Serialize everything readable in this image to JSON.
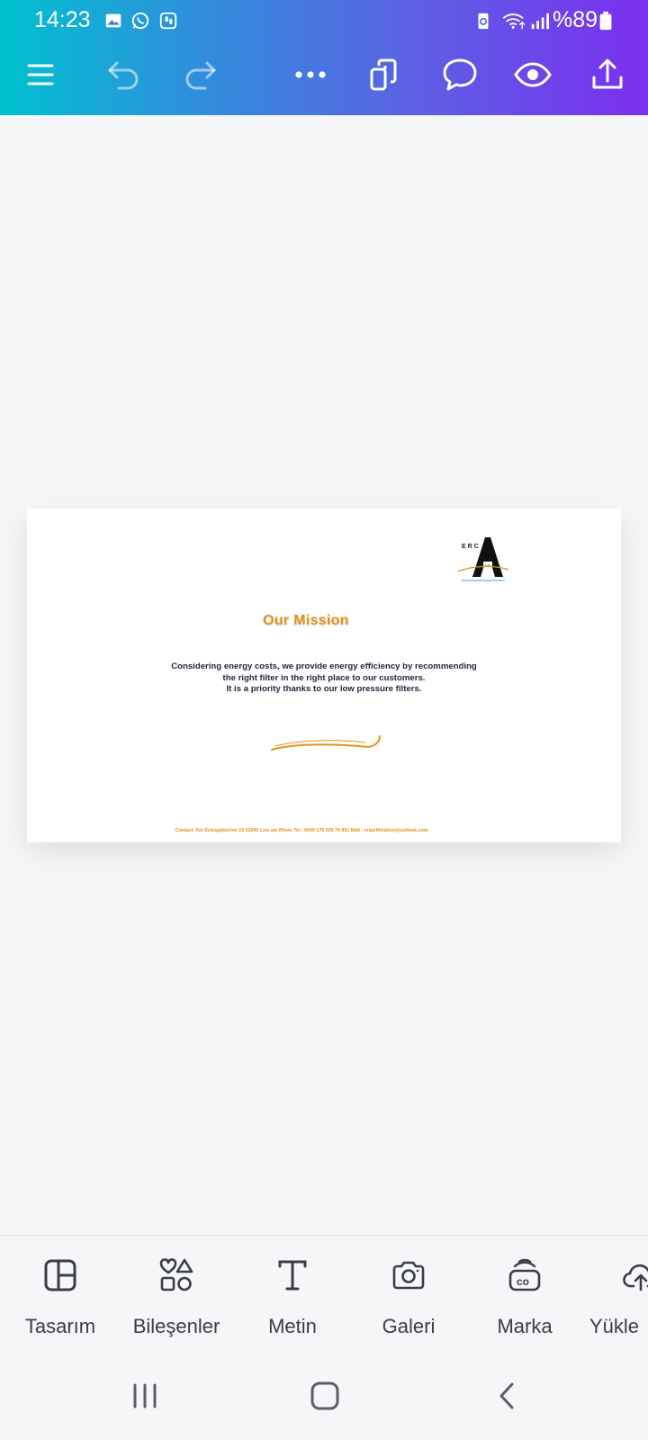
{
  "status_bar": {
    "time": "14:23",
    "battery_text": "%89",
    "notification_icons": [
      "gallery-icon",
      "whatsapp-icon",
      "footsteps-icon"
    ],
    "system_icons": [
      "battery-saver-icon",
      "wifi-icon",
      "signal-icon",
      "battery-icon"
    ]
  },
  "toolbar": {
    "colors": {
      "gradient_start": "#00c1cf",
      "gradient_end": "#7b2ff0"
    },
    "buttons": [
      "menu-icon",
      "undo-icon",
      "redo-icon",
      "more-icon",
      "pages-icon",
      "comment-icon",
      "preview-icon",
      "share-icon"
    ]
  },
  "design": {
    "logo_text": "ERC AIR",
    "title": "Our  Mission",
    "body_lines": [
      "Considering energy costs, we provide energy efficiency by recommending",
      "the right filter in the right place to our customers.",
      "It is a priority thanks to our low pressure filters."
    ],
    "contact": "Contact: Am Schoppbüchel 19 53545 Linz am Rhein    Tel : 0049 176 625 74 851  Mail : erlairfiltration@outlook.com",
    "accent_color": "#e68f1c"
  },
  "bottom_tools": [
    {
      "label": "Tasarım",
      "icon": "layout-icon"
    },
    {
      "label": "Bileşenler",
      "icon": "elements-icon"
    },
    {
      "label": "Metin",
      "icon": "text-icon"
    },
    {
      "label": "Galeri",
      "icon": "camera-icon"
    },
    {
      "label": "Marka",
      "icon": "brand-icon"
    },
    {
      "label": "Yükle",
      "icon": "upload-cloud-icon"
    }
  ],
  "nav_bar": [
    "recent-apps-icon",
    "home-icon",
    "back-icon"
  ]
}
